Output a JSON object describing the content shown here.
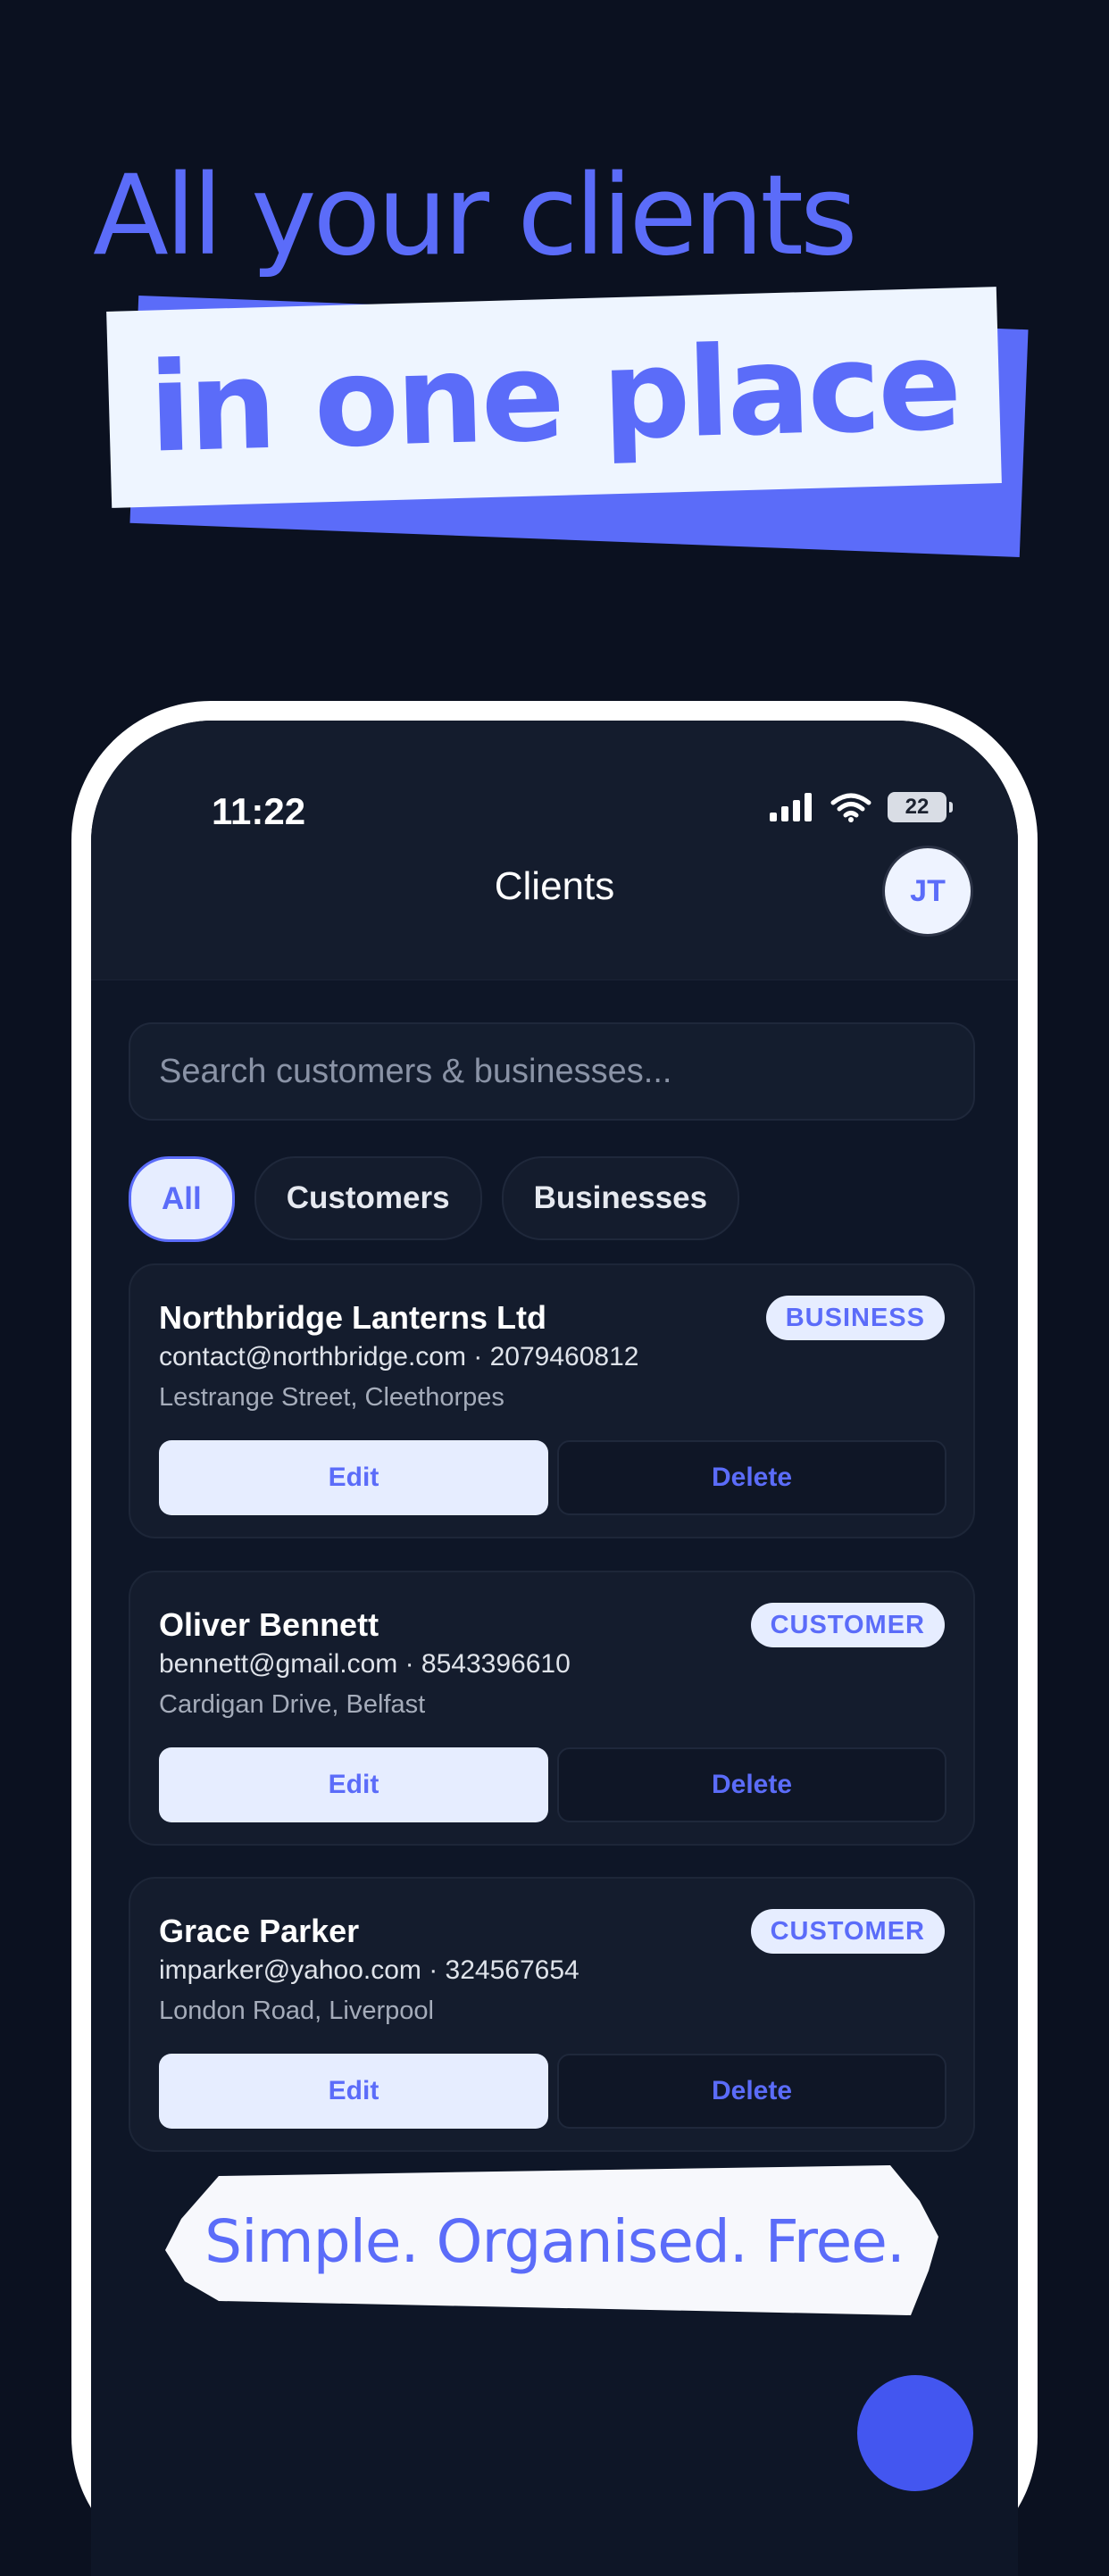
{
  "promo": {
    "headline": "All your clients",
    "banner": "in one place",
    "tagline": "Simple. Organised. Free."
  },
  "statusbar": {
    "time": "11:22",
    "battery": "22"
  },
  "header": {
    "title": "Clients",
    "avatar_initials": "JT"
  },
  "search": {
    "placeholder": "Search customers & businesses..."
  },
  "filters": [
    {
      "label": "All",
      "active": true
    },
    {
      "label": "Customers",
      "active": false
    },
    {
      "label": "Businesses",
      "active": false
    }
  ],
  "clients": [
    {
      "name": "Northbridge Lanterns Ltd",
      "contact": "contact@northbridge.com · 2079460812",
      "address": "Lestrange Street, Cleethorpes",
      "type": "BUSINESS",
      "edit_label": "Edit",
      "delete_label": "Delete"
    },
    {
      "name": "Oliver Bennett",
      "contact": "bennett@gmail.com · 8543396610",
      "address": "Cardigan Drive, Belfast",
      "type": "CUSTOMER",
      "edit_label": "Edit",
      "delete_label": "Delete"
    },
    {
      "name": "Grace Parker",
      "contact": "imparker@yahoo.com · 324567654",
      "address": "London Road, Liverpool",
      "type": "CUSTOMER",
      "edit_label": "Edit",
      "delete_label": "Delete"
    }
  ],
  "colors": {
    "accent": "#5b6cf9",
    "background": "#0b1120",
    "card": "#141c2d",
    "chip_active_bg": "#e6edff"
  },
  "icons": [
    "signal-icon",
    "wifi-icon",
    "battery-icon"
  ]
}
